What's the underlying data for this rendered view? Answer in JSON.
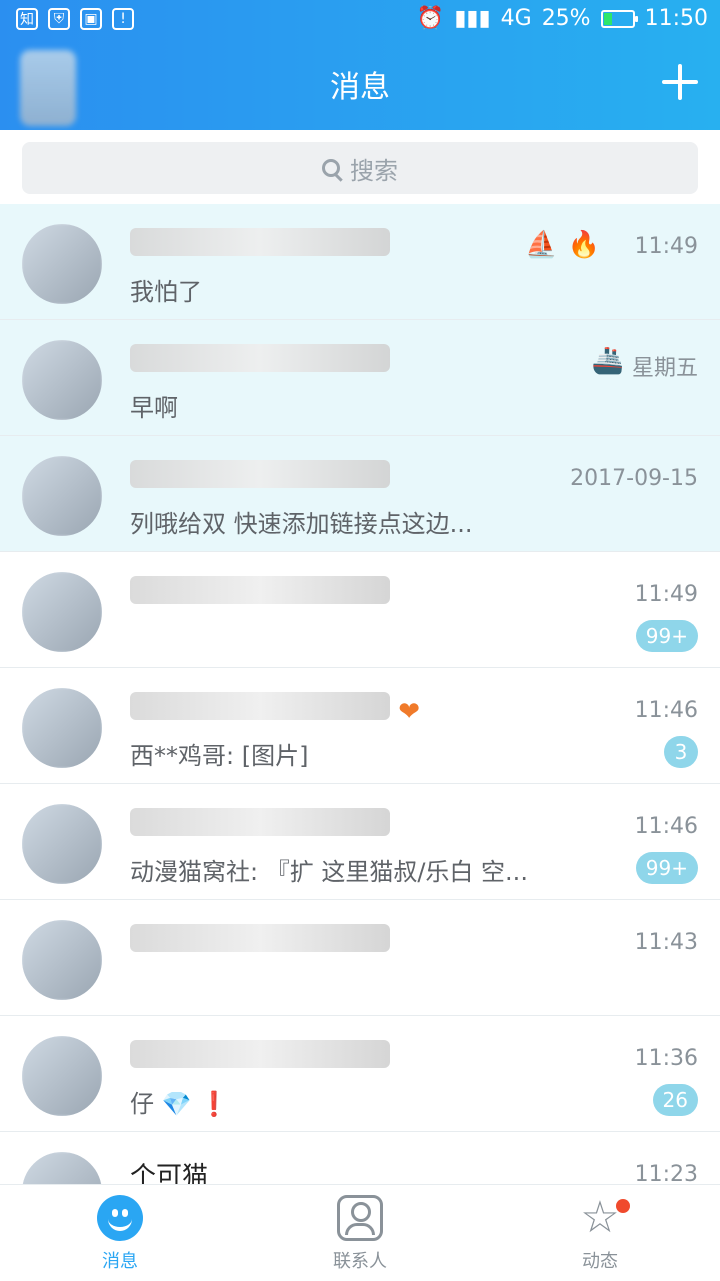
{
  "status_bar": {
    "left_icons": [
      "zhihu-icon",
      "shield-icon",
      "gallery-icon",
      "warning-icon"
    ],
    "right": {
      "icons": [
        "alarm-icon",
        "signal-icon",
        "network-4g-icon"
      ],
      "battery_text": "25%",
      "time": "11:50"
    }
  },
  "header": {
    "title": "消息"
  },
  "search": {
    "placeholder": "搜索"
  },
  "conversations": [
    {
      "preview": "我怕了",
      "time": "11:49",
      "tags": [
        "sailboat",
        "flame"
      ]
    },
    {
      "preview": "早啊",
      "time": "星期五",
      "tags": [
        "ship"
      ]
    },
    {
      "preview": "列哦给双 快速添加链接点这边...",
      "time": "2017-09-15",
      "tags": []
    },
    {
      "preview": "",
      "time": "11:49",
      "badge": "99+",
      "tags": []
    },
    {
      "preview": "西**鸡哥: [图片]",
      "time": "11:46",
      "badge": "3",
      "tags": [
        "heart"
      ]
    },
    {
      "preview": "动漫猫窝社: 『扩     这里猫叔/乐白 空...",
      "time": "11:46",
      "badge": "99+",
      "tags": []
    },
    {
      "preview": "",
      "time": "11:43",
      "tags": []
    },
    {
      "preview": "仔",
      "time": "11:36",
      "badge": "26",
      "tags": [
        "diamond",
        "exclamation"
      ]
    },
    {
      "preview": "个可猫",
      "time": "11:23",
      "tags": []
    }
  ],
  "tabs": [
    {
      "label": "消息",
      "active": true
    },
    {
      "label": "联系人",
      "active": false
    },
    {
      "label": "动态",
      "active": false,
      "notify": true
    }
  ],
  "colors": {
    "accent": "#2aa6f3",
    "pinned_bg": "#e8f8fb",
    "badge": "#8fd6ea",
    "notify_dot": "#f04a2d"
  }
}
